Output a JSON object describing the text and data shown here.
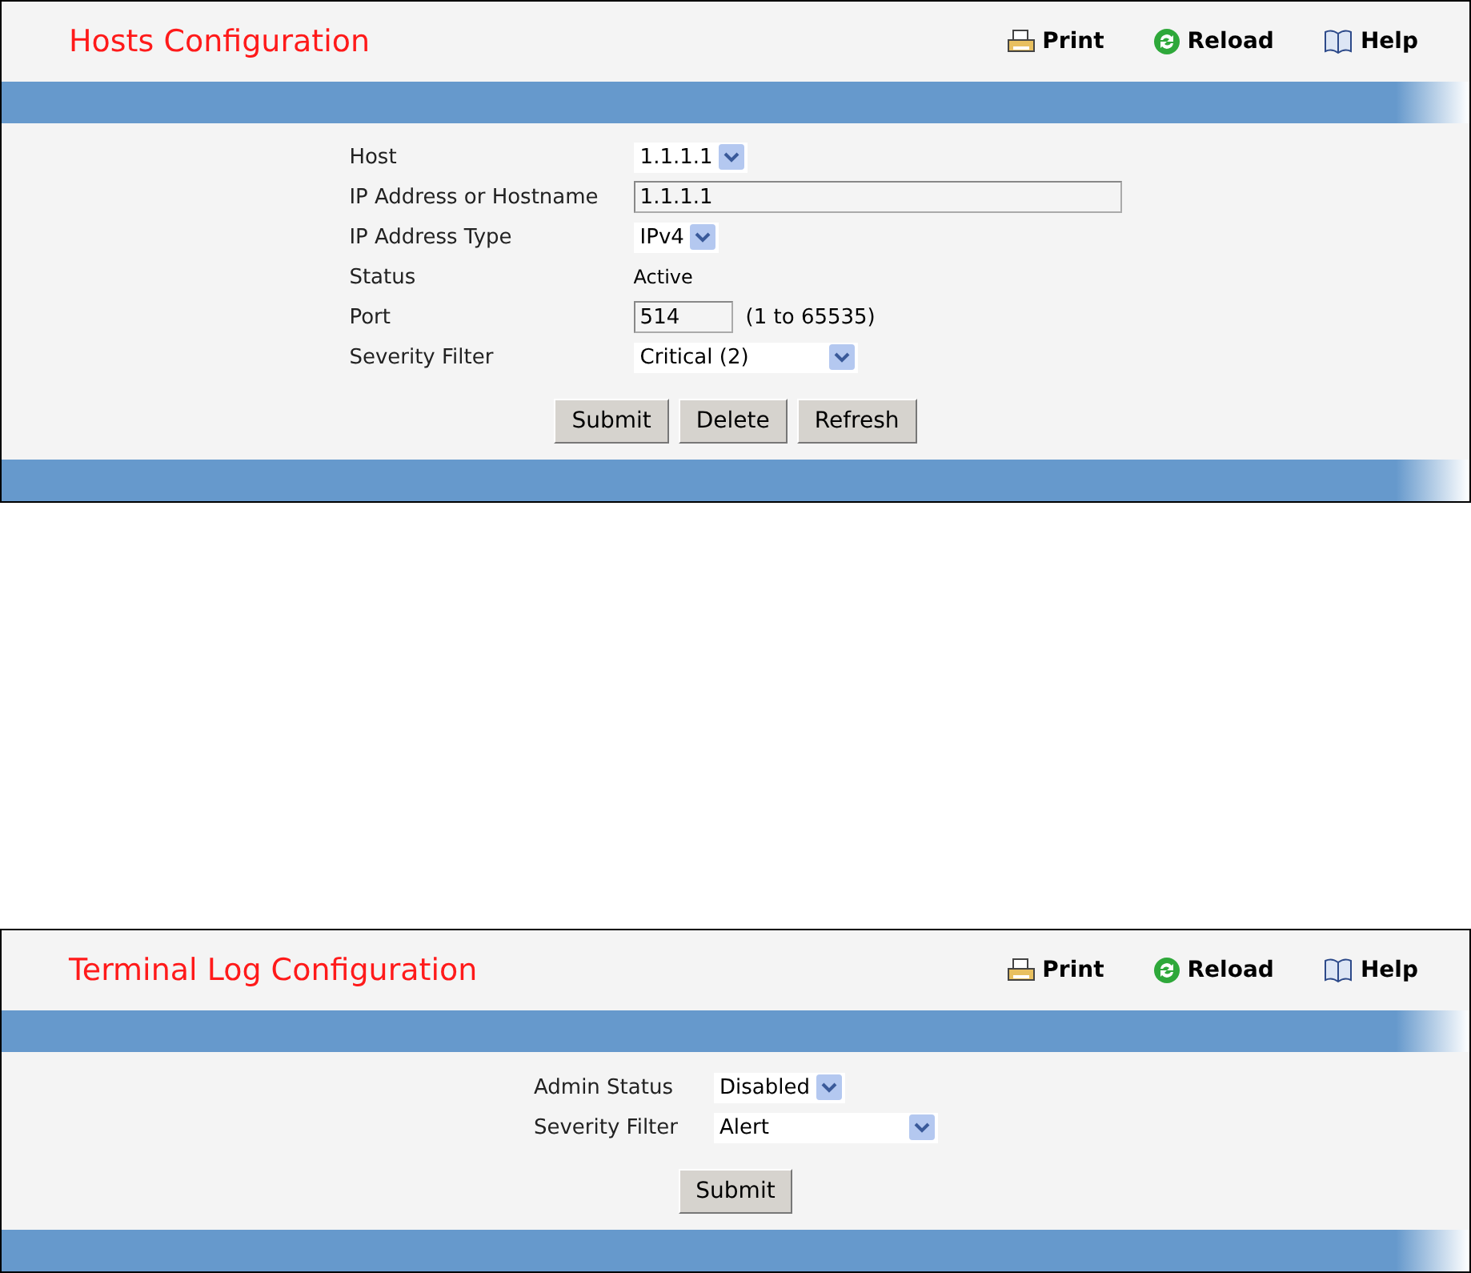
{
  "panels": [
    {
      "title": "Hosts Configuration",
      "toolbar": [
        {
          "kind": "print",
          "label": "Print"
        },
        {
          "kind": "reload",
          "label": "Reload"
        },
        {
          "kind": "help",
          "label": "Help"
        }
      ],
      "fields": [
        {
          "label": "Host",
          "kind": "select",
          "value": "1.1.1.1"
        },
        {
          "label": "IP Address or Hostname",
          "kind": "wide_input",
          "value": "1.1.1.1"
        },
        {
          "label": "IP Address Type",
          "kind": "select",
          "value": "IPv4"
        },
        {
          "label": "Status",
          "kind": "text",
          "value": "Active"
        },
        {
          "label": "Port",
          "kind": "input",
          "value": "514",
          "hint": "(1 to 65535)"
        },
        {
          "label": "Severity Filter",
          "kind": "wide_select",
          "value": "Critical (2)"
        }
      ],
      "buttons": [
        "Submit",
        "Delete",
        "Refresh"
      ]
    },
    {
      "title": "Terminal Log Configuration",
      "toolbar": [
        {
          "kind": "print",
          "label": "Print"
        },
        {
          "kind": "reload",
          "label": "Reload"
        },
        {
          "kind": "help",
          "label": "Help"
        }
      ],
      "fields": [
        {
          "label": "Admin Status",
          "kind": "select",
          "value": "Disabled"
        },
        {
          "label": "Severity Filter",
          "kind": "wide_select",
          "value": "Alert"
        }
      ],
      "buttons": [
        "Submit"
      ]
    }
  ]
}
